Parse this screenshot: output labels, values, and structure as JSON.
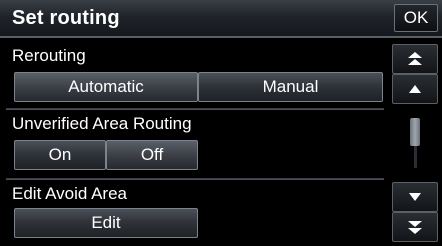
{
  "header": {
    "title": "Set routing",
    "ok_label": "OK"
  },
  "sections": [
    {
      "label": "Rerouting",
      "options": [
        "Automatic",
        "Manual"
      ],
      "selected": "Automatic"
    },
    {
      "label": "Unverified Area Routing",
      "options": [
        "On",
        "Off"
      ],
      "selected": "Off"
    },
    {
      "label": "Edit Avoid Area",
      "options": [
        "Edit"
      ]
    }
  ],
  "scrollbar": {
    "icons": [
      "double-chevron-up-icon",
      "chevron-up-icon",
      "chevron-down-icon",
      "double-chevron-down-icon"
    ]
  }
}
